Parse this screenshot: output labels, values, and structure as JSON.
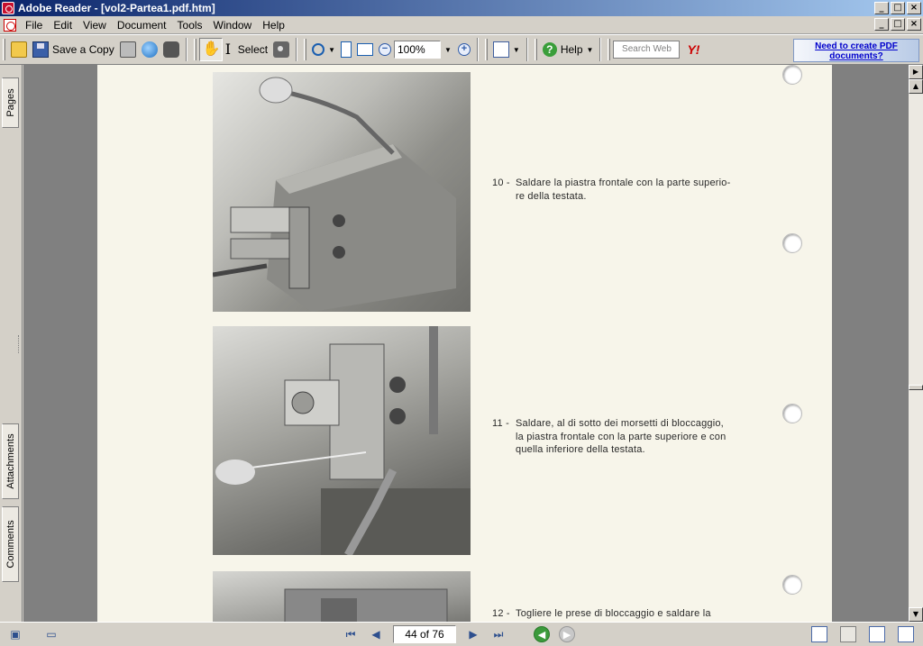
{
  "window": {
    "title": "Adobe Reader - [vol2-Partea1.pdf.htm]",
    "controls": {
      "minimize": "_",
      "maximize": "□",
      "close": "×"
    }
  },
  "menubar": {
    "items": [
      "File",
      "Edit",
      "View",
      "Document",
      "Tools",
      "Window",
      "Help"
    ]
  },
  "toolbar": {
    "save_copy_label": "Save a Copy",
    "select_label": "Select",
    "zoom_value": "100%",
    "help_label": "Help",
    "search_placeholder": "Search Web",
    "yahoo_label": "Y!",
    "ad_text": "Need to create PDF documents?"
  },
  "navpane": {
    "tabs": [
      "Pages",
      "Attachments",
      "Comments"
    ]
  },
  "document": {
    "captions": [
      {
        "num": "10 -",
        "line1": "Saldare la piastra frontale con la parte superio-",
        "line2": "re della testata."
      },
      {
        "num": "11 -",
        "line1": "Saldare, al di sotto dei morsetti di bloccaggio,",
        "line2": "la piastra frontale con la parte superiore e con",
        "line3": "quella inferiore della testata."
      },
      {
        "num": "12 -",
        "line1": "Togliere le prese di bloccaggio e saldare la"
      }
    ]
  },
  "statusbar": {
    "page_indicator": "44 of 76"
  },
  "icons": {
    "open": "open-folder-icon",
    "save": "save-icon",
    "print": "print-icon",
    "email": "email-icon",
    "search": "search-binoculars-icon",
    "hand": "hand-icon",
    "select": "text-select-icon",
    "snapshot": "snapshot-camera-icon",
    "zoom_in": "zoom-in-icon",
    "zoom_out": "zoom-out-icon",
    "zoom_plus": "zoom-plus-icon",
    "help": "help-icon"
  }
}
